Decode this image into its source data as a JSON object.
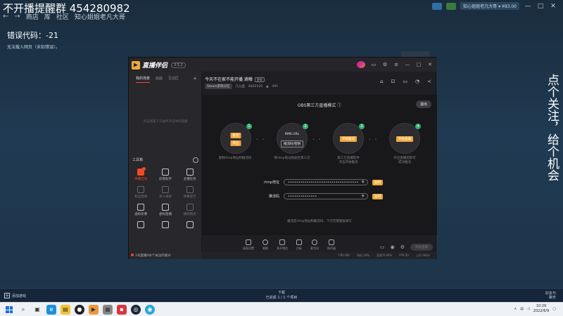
{
  "steam": {
    "title": "不开播提醒群  454280982",
    "nav": [
      "商店",
      "库",
      "社区",
      "知心姐姐老凡大哥"
    ],
    "user_label": "知心姐姐老凡大哥 ▾ ¥83.00",
    "error_code": "错误代码：-21",
    "error_msg": "无法载入网页（未知错误）。",
    "add_game": "添加游戏",
    "download_title": "下载",
    "download_sub": "已完成 1 / 1 个项目",
    "friends": "好友与\n聊天"
  },
  "app": {
    "brand": "直播伴侣",
    "version": "3.5.2",
    "left_tabs": [
      "我的场景",
      "画面",
      "互动区"
    ],
    "left_empty": "点击配置下方插件开启你的直播",
    "tools_title": "工具箱",
    "tools": [
      {
        "label": "弹幕互动",
        "state": "hot"
      },
      {
        "label": "房管助手",
        "state": "normal"
      },
      {
        "label": "主播任务",
        "state": "normal"
      },
      {
        "label": "粉丝勋章",
        "state": "dim"
      },
      {
        "label": "关人录屏",
        "state": "dim"
      },
      {
        "label": "弹幕提示",
        "state": "dim"
      },
      {
        "label": "虚拟形象",
        "state": "normal"
      },
      {
        "label": "虚拟直播",
        "state": "normal"
      },
      {
        "label": "横屏模式",
        "state": "dim"
      },
      {
        "label": "",
        "state": "normal"
      },
      {
        "label": "",
        "state": "normal"
      },
      {
        "label": "",
        "state": "normal"
      }
    ],
    "left_footer": "1号直播间4个关注的观众",
    "room_title": "今天不在家不能开播 滴嗷",
    "room_tag": "更换",
    "room_category": "Steam游戏分区",
    "room_fans": "几公里",
    "room_id": "8462120",
    "room_hot": "491",
    "mode_title": "OBS第三方直播模式",
    "exit": "退出",
    "steps": [
      {
        "num": "1",
        "pills": [
          "推流",
          "开启"
        ],
        "caption": "复制rtmp地址和推流码"
      },
      {
        "num": "2",
        "pills": [
          "RMS URL",
          "推流码/密钥"
        ],
        "caption": "将rtmp地址粘贴至第三方"
      },
      {
        "num": "3",
        "pills": [
          "开始推流"
        ],
        "caption": "第三方直播软件\n点击开始推流"
      },
      {
        "num": "4",
        "pills": [
          "开始直播"
        ],
        "caption": "开启直播后即可\n成功推流"
      }
    ],
    "rtmp_label": "rtmp地址",
    "rtmp_value": "••••••••••••••••••••••••••••••••••",
    "key_label": "推流码",
    "key_value": "••••••••••••••",
    "copy": "复制",
    "hint": "推流后rtmp地址和推流码，下次无需重复填写",
    "bottom_tools": [
      "画面设置",
      "美颜",
      "多开预览",
      "白板",
      "麦克风",
      "扬声器"
    ],
    "live_btn": "开始直播",
    "status": [
      "CPU:8%",
      "内存:34%",
      "丢帧:0.00%",
      "FPS:30",
      "上行:0kb/s"
    ]
  },
  "side_text": "点个关注，给个机会",
  "taskbar": {
    "time": "10:29",
    "date": "2022/6/9"
  }
}
